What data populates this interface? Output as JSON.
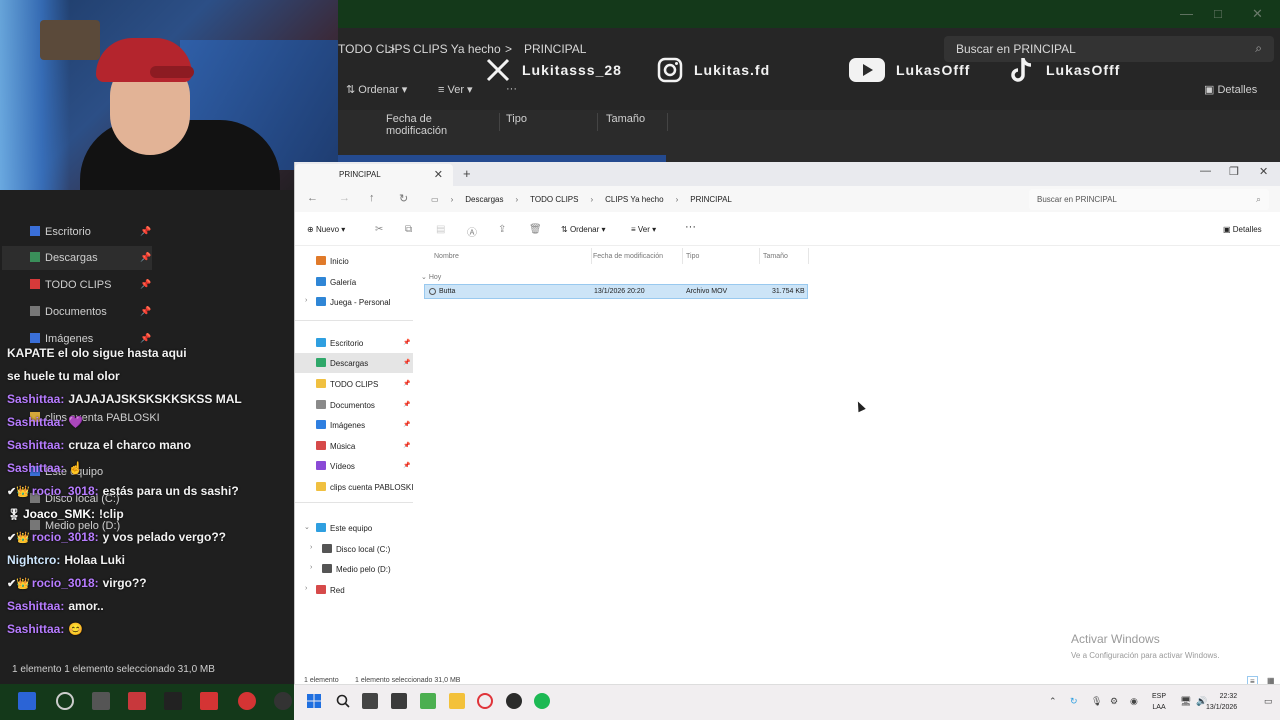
{
  "background_window": {
    "breadcrumbs": [
      "TODO CLIPS",
      ">",
      "CLIPS Ya hecho",
      ">",
      "PRINCIPAL"
    ],
    "search_placeholder": "Buscar en PRINCIPAL",
    "toolbar": {
      "sort": "Ordenar",
      "view": "Ver",
      "more": "···",
      "details": "Detalles"
    },
    "columns": [
      "Fecha de modificación",
      "Tipo",
      "Tamaño"
    ],
    "nav": [
      {
        "label": "Escritorio",
        "color": "#3a6fd8"
      },
      {
        "label": "Descargas",
        "color": "#3a8f5a"
      },
      {
        "label": "TODO CLIPS",
        "color": "#d63a3a"
      },
      {
        "label": "Documentos",
        "color": "#777777"
      },
      {
        "label": "Imágenes",
        "color": "#3a6fd8"
      },
      {
        "label": "clips cuenta PABLOSKI",
        "color": "#d6a83a"
      },
      {
        "label": "Este equipo",
        "color": "#3a6fd8"
      },
      {
        "label": "Disco local (C:)",
        "color": "#777777"
      },
      {
        "label": "Medio pelo (D:)",
        "color": "#777777"
      }
    ],
    "status": "1 elemento     1 elemento seleccionado  31,0 MB"
  },
  "socials": [
    {
      "icon": "x-logo-icon",
      "handle": "Lukitasss_28"
    },
    {
      "icon": "instagram-icon",
      "handle": "Lukitas.fd"
    },
    {
      "icon": "youtube-icon",
      "handle": "LukasOfff"
    },
    {
      "icon": "tiktok-icon",
      "handle": "LukasOfff"
    }
  ],
  "chat": [
    {
      "user": "",
      "text": "KAPATE el olo sigue hasta aqui",
      "color": "#b77cff"
    },
    {
      "user": "",
      "text": "se huele tu mal olor",
      "color": "#f2f2f2"
    },
    {
      "user": "Sashittaa:",
      "text": "JAJAJAJSKSKSKKSKSS MAL",
      "color": "#b77cff"
    },
    {
      "user": "Sashittaa:",
      "text": "💜",
      "color": "#b77cff"
    },
    {
      "user": "Sashittaa:",
      "text": "cruza el charco mano",
      "color": "#b77cff"
    },
    {
      "user": "Sashittaa:",
      "text": "☝",
      "color": "#b77cff"
    },
    {
      "user": "rocio_3018:",
      "text": "estás para un ds sashi?",
      "color": "#b77cff"
    },
    {
      "user": "Joaco_SMK:",
      "text": "!clip",
      "color": "#ffffff"
    },
    {
      "user": "rocio_3018:",
      "text": "y vos pelado vergo??",
      "color": "#b77cff"
    },
    {
      "user": "Nightcro:",
      "text": "Holaa Luki",
      "color": "#cfe8ff"
    },
    {
      "user": "rocio_3018:",
      "text": "virgo??",
      "color": "#b77cff"
    },
    {
      "user": "Sashittaa:",
      "text": "amor..",
      "color": "#b77cff"
    },
    {
      "user": "Sashittaa:",
      "text": "😊",
      "color": "#b77cff"
    }
  ],
  "explorer": {
    "tab_title": "PRINCIPAL",
    "breadcrumbs": [
      "Descargas",
      "TODO CLIPS",
      "CLIPS Ya hecho",
      "PRINCIPAL"
    ],
    "search_placeholder": "Buscar en PRINCIPAL",
    "commands": {
      "new": "Nuevo",
      "sort": "Ordenar",
      "view": "Ver",
      "more": "···",
      "details": "Detalles"
    },
    "nav_top": [
      {
        "label": "Inicio",
        "icon": "home-icon",
        "color": "#e07a2a"
      },
      {
        "label": "Galería",
        "icon": "gallery-icon",
        "color": "#2f86d6"
      },
      {
        "label": "Juega - Personal",
        "icon": "onedrive-icon",
        "color": "#2f86d6"
      }
    ],
    "nav_pinned": [
      {
        "label": "Escritorio",
        "icon": "desktop-icon",
        "color": "#2f9fe0"
      },
      {
        "label": "Descargas",
        "icon": "downloads-icon",
        "color": "#2fa86a"
      },
      {
        "label": "TODO CLIPS",
        "icon": "folder-icon",
        "color": "#f0c040"
      },
      {
        "label": "Documentos",
        "icon": "documents-icon",
        "color": "#8a8a8a"
      },
      {
        "label": "Imágenes",
        "icon": "pictures-icon",
        "color": "#2f7fe0"
      },
      {
        "label": "Música",
        "icon": "music-icon",
        "color": "#d64a4a"
      },
      {
        "label": "Vídeos",
        "icon": "videos-icon",
        "color": "#8a4ad6"
      },
      {
        "label": "clips cuenta PABLOSKI",
        "icon": "folder-icon",
        "color": "#f0c040"
      }
    ],
    "nav_pc": [
      {
        "label": "Este equipo",
        "icon": "computer-icon",
        "color": "#2f9fe0"
      },
      {
        "label": "Disco local (C:)",
        "icon": "drive-icon",
        "color": "#555555"
      },
      {
        "label": "Medio pelo (D:)",
        "icon": "drive-icon",
        "color": "#555555"
      },
      {
        "label": "Red",
        "icon": "network-icon",
        "color": "#d64a4a"
      }
    ],
    "columns": [
      "Nombre",
      "Fecha de modificación",
      "Tipo",
      "Tamaño"
    ],
    "group": "Hoy",
    "files": [
      {
        "name": "Butta",
        "modified": "13/1/2026 20:20",
        "type": "Archivo MOV",
        "size": "31.754 KB"
      }
    ],
    "status_count": "1 elemento",
    "status_selected": "1 elemento seleccionado  31,0 MB"
  },
  "activation": {
    "title": "Activar Windows",
    "subtitle": "Ve a Configuración para activar Windows."
  },
  "taskbar": {
    "language": [
      "ESP",
      "LAA"
    ],
    "time": "22:32",
    "date": "13/1/2026"
  }
}
